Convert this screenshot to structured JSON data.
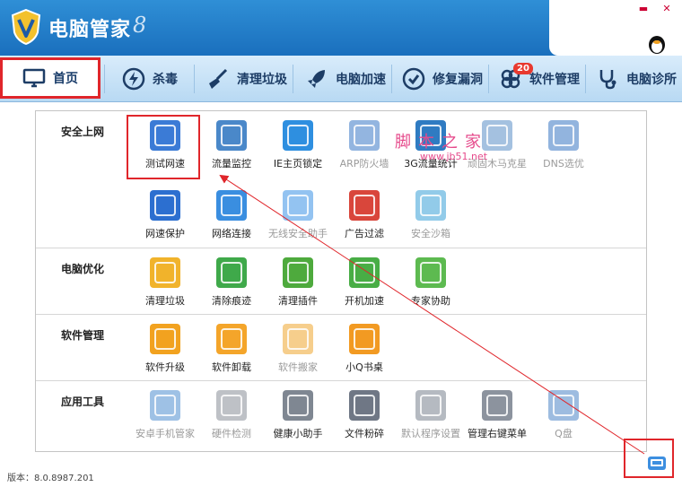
{
  "app": {
    "title": "电脑管家",
    "version_mark": "8"
  },
  "nav": {
    "items": [
      {
        "label": "首页",
        "icon": "monitor-icon"
      },
      {
        "label": "杀毒",
        "icon": "lightning-icon"
      },
      {
        "label": "清理垃圾",
        "icon": "broom-icon"
      },
      {
        "label": "电脑加速",
        "icon": "rocket-icon"
      },
      {
        "label": "修复漏洞",
        "icon": "shield-repair-icon"
      },
      {
        "label": "软件管理",
        "icon": "clover-icon",
        "badge": "20"
      },
      {
        "label": "电脑诊所",
        "icon": "stethoscope-icon"
      }
    ]
  },
  "sections": [
    {
      "title": "安全上网",
      "tools": [
        {
          "label": "测试网速",
          "icon": "speed-gauge-icon",
          "color": "#3b7bd6"
        },
        {
          "label": "流量监控",
          "icon": "traffic-chart-icon",
          "color": "#4a88c9"
        },
        {
          "label": "IE主页锁定",
          "icon": "ie-lock-icon",
          "color": "#2e8fe0"
        },
        {
          "label": "ARP防火墙",
          "icon": "arp-icon",
          "color": "#3c79c7",
          "dim": true
        },
        {
          "label": "3G流量统计",
          "icon": "3g-icon",
          "color": "#2f7bc2"
        },
        {
          "label": "顽固木马克星",
          "icon": "horse-icon",
          "color": "#5a8fc8",
          "dim": true
        },
        {
          "label": "DNS选优",
          "icon": "dns-icon",
          "color": "#3a77c4",
          "dim": true
        },
        {
          "label": "网速保护",
          "icon": "chevron-shield-icon",
          "color": "#2c6fd0"
        },
        {
          "label": "网络连接",
          "icon": "globe-link-icon",
          "color": "#3a8ee0"
        },
        {
          "label": "无线安全助手",
          "icon": "wifi-icon",
          "color": "#3b93e6",
          "dim": true
        },
        {
          "label": "广告过滤",
          "icon": "ad-filter-icon",
          "color": "#d9463b"
        },
        {
          "label": "安全沙箱",
          "icon": "sandbox-icon",
          "color": "#3aa2d8",
          "dim": true
        }
      ]
    },
    {
      "title": "电脑优化",
      "tools": [
        {
          "label": "清理垃圾",
          "icon": "broom-icon",
          "color": "#f1b32b"
        },
        {
          "label": "清除痕迹",
          "icon": "eraser-icon",
          "color": "#3fa94a"
        },
        {
          "label": "清理插件",
          "icon": "puzzle-icon",
          "color": "#4eaa3d"
        },
        {
          "label": "开机加速",
          "icon": "rocket-icon",
          "color": "#48ad45"
        },
        {
          "label": "专家协助",
          "icon": "expert-icon",
          "color": "#5dba50"
        }
      ]
    },
    {
      "title": "软件管理",
      "tools": [
        {
          "label": "软件升级",
          "icon": "upgrade-arrow-icon",
          "color": "#f2a21f"
        },
        {
          "label": "软件卸载",
          "icon": "trash-icon",
          "color": "#f4a52a"
        },
        {
          "label": "软件搬家",
          "icon": "truck-icon",
          "color": "#f0a730",
          "dim": true
        },
        {
          "label": "小Q书桌",
          "icon": "clover-icon",
          "color": "#f29a22"
        }
      ]
    },
    {
      "title": "应用工具",
      "tools": [
        {
          "label": "安卓手机管家",
          "icon": "android-m-icon",
          "color": "#4f8fd1",
          "dim": true
        },
        {
          "label": "硬件检测",
          "icon": "hardware-icon",
          "color": "#8a8f99",
          "dim": true
        },
        {
          "label": "健康小助手",
          "icon": "alarm-clock-icon",
          "color": "#7f8792"
        },
        {
          "label": "文件粉碎",
          "icon": "shredder-icon",
          "color": "#6f7785"
        },
        {
          "label": "默认程序设置",
          "icon": "gear-icon",
          "color": "#7a8290",
          "dim": true
        },
        {
          "label": "管理右键菜单",
          "icon": "mouse-icon",
          "color": "#8c939e"
        },
        {
          "label": "Q盘",
          "icon": "q-disk-icon",
          "color": "#4e86c8",
          "dim": true
        }
      ]
    }
  ],
  "watermark": {
    "text": "脚本之家",
    "url": "www.jb51.net"
  },
  "footer": {
    "version": "版本：8.0.8987.201"
  },
  "colors": {
    "highlight": "#e0262b",
    "titlebar": "#1f7cc8",
    "navbar": "#c9e2f7"
  }
}
